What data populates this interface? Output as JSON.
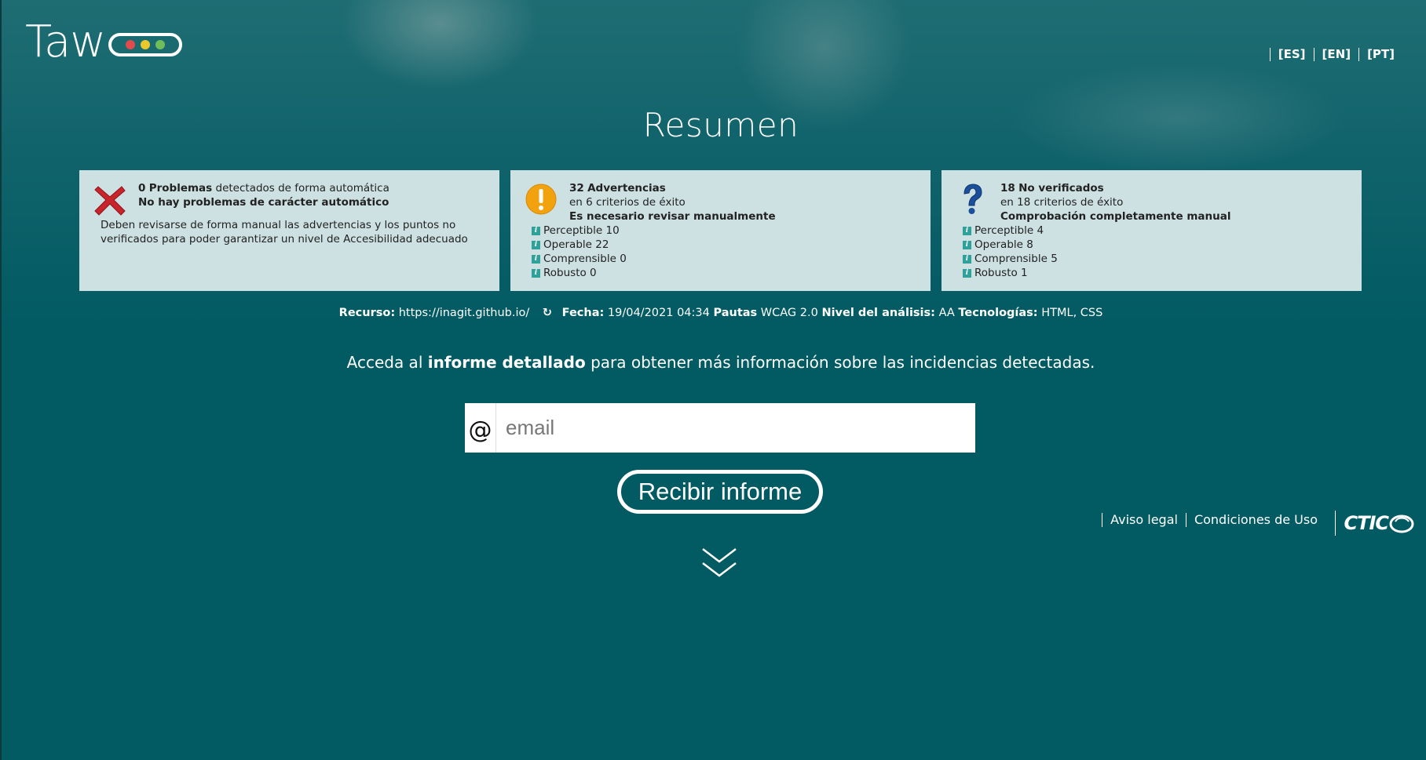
{
  "brand": {
    "logo_text": "Taw",
    "dot_colors": [
      "#e14b4b",
      "#e8c82a",
      "#6fbe59"
    ]
  },
  "languages": [
    "[ES]",
    "[EN]",
    "[PT]"
  ],
  "page_title": "Resumen",
  "cards": {
    "problems": {
      "count": "0",
      "label": "Problemas",
      "desc": "detectados de forma automática",
      "line2": "No hay problemas de carácter automático",
      "note": "Deben revisarse de forma manual las advertencias y los puntos no verificados para poder garantizar un nivel de Accesibilidad adecuado"
    },
    "warnings": {
      "count": "32",
      "label": "Advertencias",
      "criteria": "en 6 criterios de éxito",
      "line3": "Es necesario revisar manualmente",
      "items": [
        "Perceptible 10",
        "Operable 22",
        "Comprensible 0",
        "Robusto 0"
      ]
    },
    "unverified": {
      "count": "18",
      "label": "No verificados",
      "criteria": "en 18 criterios de éxito",
      "line3": "Comprobación completamente manual",
      "items": [
        "Perceptible 4",
        "Operable 8",
        "Comprensible 5",
        "Robusto 1"
      ]
    }
  },
  "meta": {
    "resource_label": "Recurso:",
    "resource_value": "https://inagit.github.io/",
    "date_label": "Fecha:",
    "date_value": "19/04/2021 04:34",
    "guidelines_label": "Pautas",
    "guidelines_value": "WCAG 2.0",
    "level_label": "Nivel del análisis:",
    "level_value": "AA",
    "tech_label": "Tecnologías:",
    "tech_value": "HTML, CSS"
  },
  "prompt": {
    "pre": "Acceda al",
    "bold": "informe detallado",
    "post": "para obtener más información sobre las incidencias detectadas."
  },
  "email": {
    "at": "@",
    "placeholder": "email",
    "value": ""
  },
  "submit_label": "Recibir informe",
  "footer": {
    "links": [
      "Aviso legal",
      "Condiciones de Uso"
    ],
    "ctic": "CTIC"
  },
  "colors": {
    "background": "#025a63",
    "card": "#cde0e2",
    "info_icon": "#2ea29a"
  }
}
